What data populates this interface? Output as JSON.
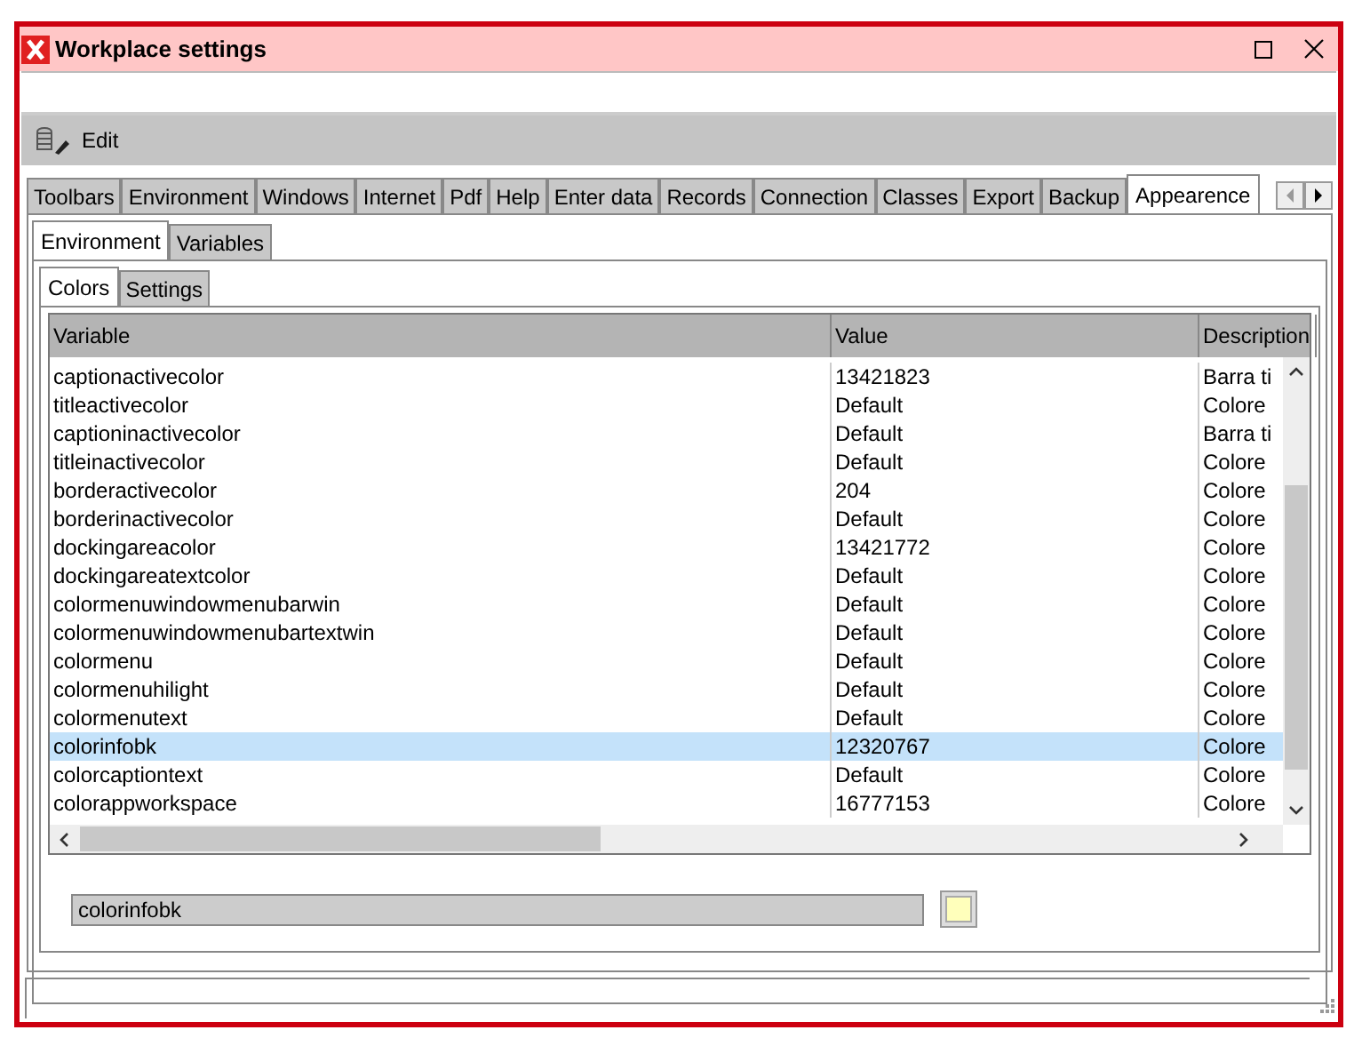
{
  "window": {
    "title": "Workplace settings"
  },
  "toolbar": {
    "items": [
      {
        "label": "Edit"
      }
    ]
  },
  "tabs": [
    {
      "label": "Toolbars",
      "selected": false
    },
    {
      "label": "Environment",
      "selected": false
    },
    {
      "label": "Windows",
      "selected": false
    },
    {
      "label": "Internet",
      "selected": false
    },
    {
      "label": "Pdf",
      "selected": false
    },
    {
      "label": "Help",
      "selected": false
    },
    {
      "label": "Enter data",
      "selected": false
    },
    {
      "label": "Records",
      "selected": false
    },
    {
      "label": "Connection",
      "selected": false
    },
    {
      "label": "Classes",
      "selected": false
    },
    {
      "label": "Export",
      "selected": false
    },
    {
      "label": "Backup",
      "selected": false
    },
    {
      "label": "Appearence",
      "selected": true
    }
  ],
  "subtabs": [
    {
      "label": "Environment",
      "selected": true
    },
    {
      "label": "Variables",
      "selected": false
    }
  ],
  "inner_tabs": [
    {
      "label": "Colors",
      "selected": true
    },
    {
      "label": "Settings",
      "selected": false
    }
  ],
  "table": {
    "columns": [
      "Variable",
      "Value",
      "Description"
    ],
    "rows": [
      {
        "variable": "captionactivecolor",
        "value": "13421823",
        "description": "Barra ti",
        "selected": false
      },
      {
        "variable": "titleactivecolor",
        "value": "Default",
        "description": "Colore",
        "selected": false
      },
      {
        "variable": "captioninactivecolor",
        "value": "Default",
        "description": "Barra ti",
        "selected": false
      },
      {
        "variable": "titleinactivecolor",
        "value": "Default",
        "description": "Colore",
        "selected": false
      },
      {
        "variable": "borderactivecolor",
        "value": "204",
        "description": "Colore",
        "selected": false
      },
      {
        "variable": "borderinactivecolor",
        "value": "Default",
        "description": "Colore",
        "selected": false
      },
      {
        "variable": "dockingareacolor",
        "value": "13421772",
        "description": "Colore",
        "selected": false
      },
      {
        "variable": "dockingareatextcolor",
        "value": "Default",
        "description": "Colore",
        "selected": false
      },
      {
        "variable": "colormenuwindowmenubarwin",
        "value": "Default",
        "description": "Colore",
        "selected": false
      },
      {
        "variable": "colormenuwindowmenubartextwin",
        "value": "Default",
        "description": "Colore",
        "selected": false
      },
      {
        "variable": "colormenu",
        "value": "Default",
        "description": "Colore",
        "selected": false
      },
      {
        "variable": "colormenuhilight",
        "value": "Default",
        "description": "Colore",
        "selected": false
      },
      {
        "variable": "colormenutext",
        "value": "Default",
        "description": "Colore",
        "selected": false
      },
      {
        "variable": "colorinfobk",
        "value": "12320767",
        "description": "Colore",
        "selected": true
      },
      {
        "variable": "colorcaptiontext",
        "value": "Default",
        "description": "Colore",
        "selected": false
      },
      {
        "variable": "colorappworkspace",
        "value": "16777153",
        "description": "Colore",
        "selected": false
      }
    ]
  },
  "editor": {
    "value": "colorinfobk",
    "color": "#ffffbb"
  }
}
